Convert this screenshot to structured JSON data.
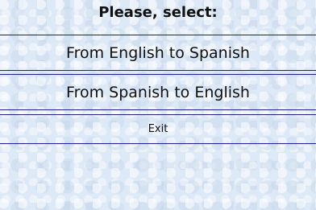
{
  "header": {
    "title": "Please, select:"
  },
  "menu": {
    "items": [
      {
        "label": "From English to Spanish"
      },
      {
        "label": "From Spanish to English"
      },
      {
        "label": "Exit"
      }
    ]
  },
  "colors": {
    "background": "#dde9f6",
    "divider": "#1f1f8f",
    "text": "#111111"
  }
}
